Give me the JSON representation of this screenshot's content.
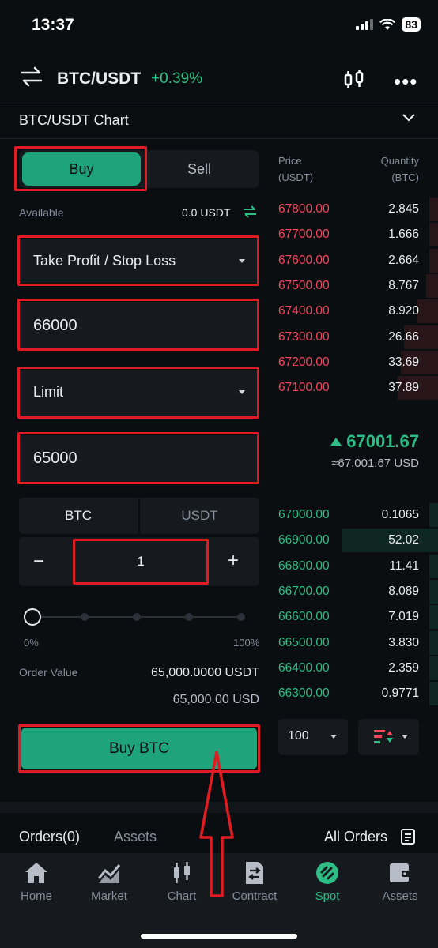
{
  "status": {
    "time": "13:37",
    "battery": "83"
  },
  "header": {
    "pair": "BTC/USDT",
    "change": "+0.39%"
  },
  "chart_row": {
    "title": "BTC/USDT Chart"
  },
  "side_tabs": {
    "buy": "Buy",
    "sell": "Sell"
  },
  "available": {
    "label": "Available",
    "value": "0.0 USDT"
  },
  "order_type": {
    "value": "Take Profit / Stop Loss"
  },
  "trigger_price": {
    "value": "66000"
  },
  "price_type": {
    "value": "Limit"
  },
  "limit_price": {
    "value": "65000"
  },
  "unit_tabs": {
    "btc": "BTC",
    "usdt": "USDT"
  },
  "quantity": {
    "minus": "−",
    "value": "1",
    "plus": "+"
  },
  "slider": {
    "min_label": "0%",
    "max_label": "100%",
    "percent": 0
  },
  "order_value": {
    "label": "Order Value",
    "value": "65,000.0000 USDT",
    "usd": "65,000.00 USD"
  },
  "buy_button": {
    "label": "Buy BTC"
  },
  "order_book": {
    "price_header": "Price",
    "price_unit": "(USDT)",
    "qty_header": "Quantity",
    "qty_unit": "(BTC)",
    "asks": [
      {
        "price": "67800.00",
        "qty": "2.845",
        "depth": 0.05
      },
      {
        "price": "67700.00",
        "qty": "1.666",
        "depth": 0.05
      },
      {
        "price": "67600.00",
        "qty": "2.664",
        "depth": 0.05
      },
      {
        "price": "67500.00",
        "qty": "8.767",
        "depth": 0.07
      },
      {
        "price": "67400.00",
        "qty": "8.920",
        "depth": 0.12
      },
      {
        "price": "67300.00",
        "qty": "26.66",
        "depth": 0.2
      },
      {
        "price": "67200.00",
        "qty": "33.69",
        "depth": 0.22
      },
      {
        "price": "67100.00",
        "qty": "37.89",
        "depth": 0.24
      }
    ],
    "last_price": "67001.67",
    "last_price_usd": "≈67,001.67 USD",
    "bids": [
      {
        "price": "67000.00",
        "qty": "0.1065",
        "depth": 0.05
      },
      {
        "price": "66900.00",
        "qty": "52.02",
        "depth": 0.57
      },
      {
        "price": "66800.00",
        "qty": "11.41",
        "depth": 0.05
      },
      {
        "price": "66700.00",
        "qty": "8.089",
        "depth": 0.05
      },
      {
        "price": "66600.00",
        "qty": "7.019",
        "depth": 0.05
      },
      {
        "price": "66500.00",
        "qty": "3.830",
        "depth": 0.05
      },
      {
        "price": "66400.00",
        "qty": "2.359",
        "depth": 0.05
      },
      {
        "price": "66300.00",
        "qty": "0.9771",
        "depth": 0.05
      }
    ],
    "depth_select": "100"
  },
  "bottom_tabs": {
    "orders": "Orders(0)",
    "assets": "Assets",
    "all_orders": "All Orders"
  },
  "nav": [
    {
      "label": "Home",
      "icon": "home-icon"
    },
    {
      "label": "Market",
      "icon": "market-icon"
    },
    {
      "label": "Chart",
      "icon": "chart-icon"
    },
    {
      "label": "Contract",
      "icon": "contract-icon"
    },
    {
      "label": "Spot",
      "icon": "spot-icon"
    },
    {
      "label": "Assets",
      "icon": "wallet-icon"
    }
  ],
  "colors": {
    "accent_green": "#1fa37a",
    "ask_red": "#f6465d",
    "bid_green": "#2ebd85",
    "highlight_red": "#e11b22"
  }
}
